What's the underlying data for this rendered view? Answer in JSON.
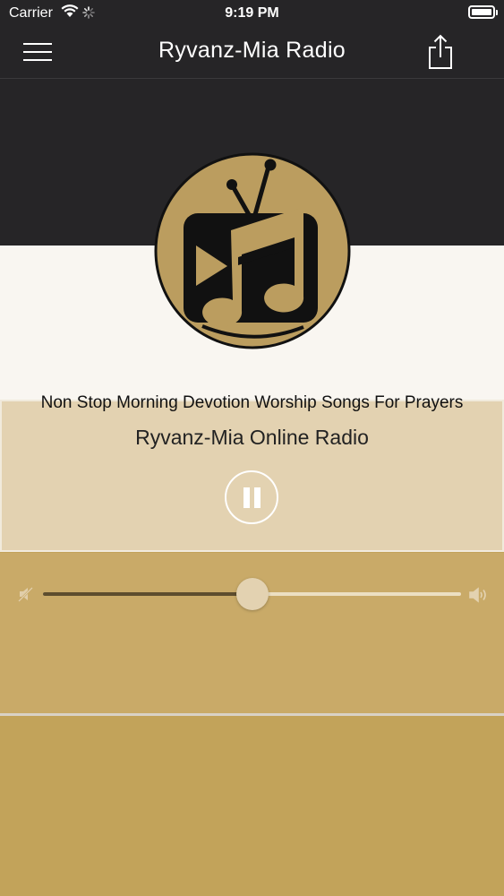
{
  "status_bar": {
    "carrier": "Carrier",
    "time": "9:19 PM"
  },
  "nav": {
    "title": "Ryvanz-Mia Radio",
    "menu_icon": "hamburger-menu-icon",
    "share_icon": "share-icon"
  },
  "player": {
    "song_title": "Non Stop Morning Devotion Worship Songs For Prayers",
    "station_name": "Ryvanz-Mia Online Radio",
    "state": "playing",
    "control_icon": "pause-icon"
  },
  "volume": {
    "level": 0.5,
    "min_icon": "volume-mute-icon",
    "max_icon": "volume-high-icon"
  },
  "colors": {
    "header_bg": "#262527",
    "hero_light": "#f9f6f1",
    "info_panel": "#e3d2b1",
    "volume_panel": "#c9aa68",
    "bottom_panel": "#c2a35a",
    "logo_gold": "#bb9d5f"
  }
}
